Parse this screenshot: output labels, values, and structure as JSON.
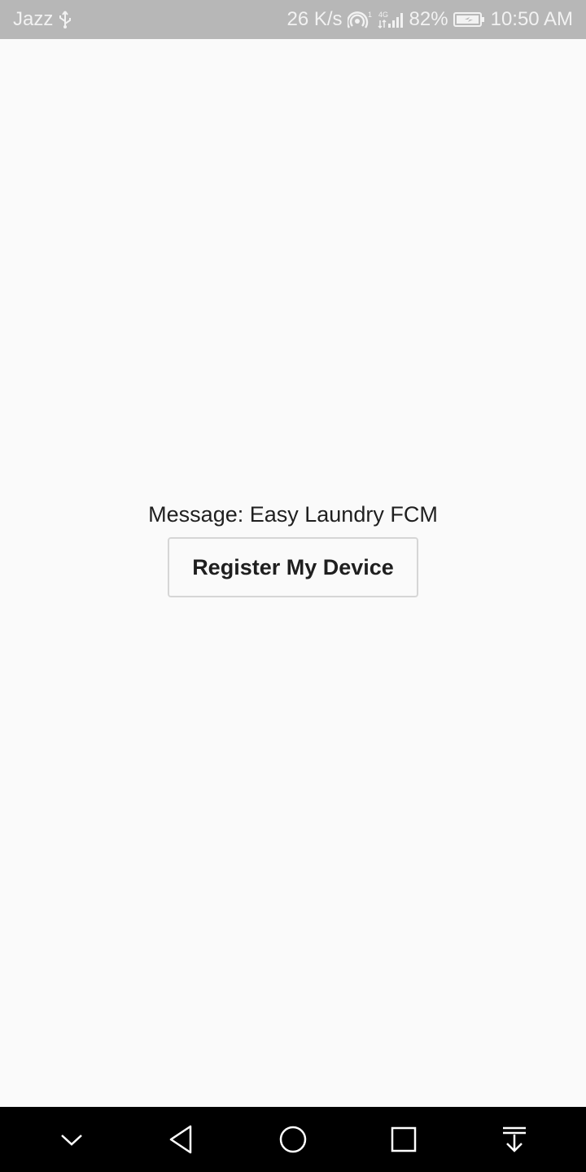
{
  "status_bar": {
    "carrier": "Jazz",
    "speed": "26 K/s",
    "network_type": "4G",
    "battery": "82%",
    "time": "10:50 AM",
    "icons": [
      "usb-icon",
      "hotspot-icon",
      "signal-icon",
      "battery-icon"
    ]
  },
  "main": {
    "message": "Message: Easy Laundry FCM",
    "register_button_label": "Register My Device"
  },
  "nav_bar": {
    "icons": [
      "chevron-down-icon",
      "back-icon",
      "home-icon",
      "recents-icon",
      "notification-pull-icon"
    ]
  },
  "colors": {
    "status_bar_bg": "#b7b7b7",
    "page_bg": "#fafafa",
    "nav_bar_bg": "#000000",
    "text": "#1f1f1f",
    "button_border": "#d6d6d6"
  }
}
